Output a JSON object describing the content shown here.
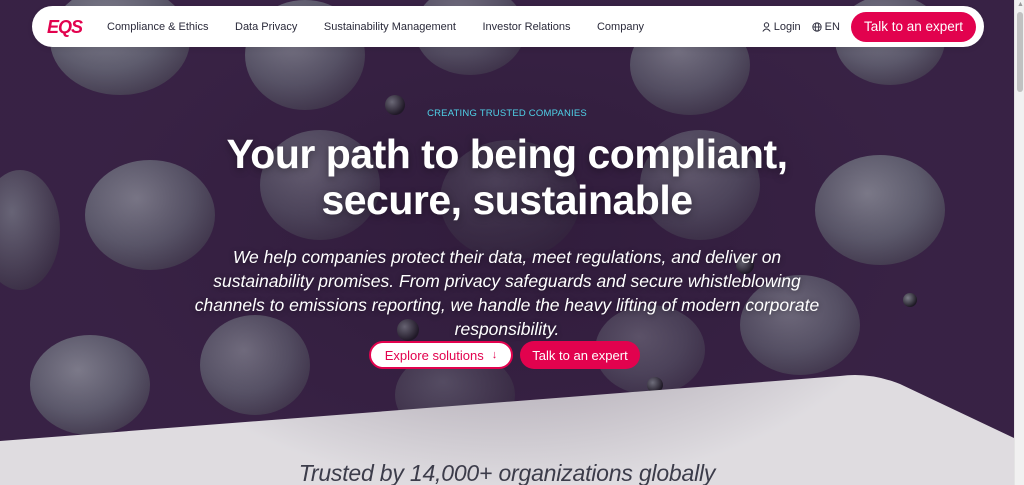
{
  "colors": {
    "brand": "#e2024e",
    "eyebrow": "#4fd1e8",
    "hero_bg": "#3a2448"
  },
  "logo": {
    "text": "EQS"
  },
  "nav": {
    "items": [
      {
        "label": "Compliance & Ethics"
      },
      {
        "label": "Data Privacy"
      },
      {
        "label": "Sustainability Management"
      },
      {
        "label": "Investor Relations"
      },
      {
        "label": "Company"
      }
    ],
    "login_label": "Login",
    "login_icon": "user-icon",
    "lang_label": "EN",
    "lang_icon": "globe-icon",
    "cta_label": "Talk to an expert"
  },
  "hero": {
    "eyebrow": "CREATING TRUSTED COMPANIES",
    "headline_line1": "Your path to being compliant,",
    "headline_line2": "secure, sustainable",
    "subtext": "We help companies protect their data, meet regulations, and deliver on sustainability promises. From privacy safeguards and secure whistleblowing channels to emissions reporting, we handle the heavy lifting of modern corporate responsibility.",
    "explore_label": "Explore solutions",
    "explore_icon": "arrow-down-icon",
    "talk_label": "Talk to an expert"
  },
  "trusted": {
    "text": "Trusted by 14,000+ organizations globally"
  }
}
